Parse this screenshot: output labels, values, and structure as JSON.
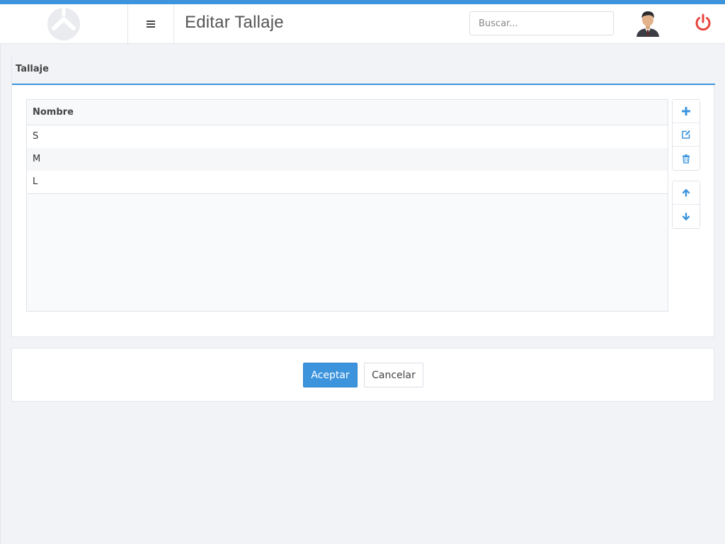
{
  "header": {
    "title": "Editar Tallaje",
    "search_placeholder": "Buscar...",
    "logo_icon": "app-logo-icon",
    "menu_icon": "hamburger-menu-icon",
    "avatar_icon": "user-avatar-icon",
    "power_icon": "power-icon"
  },
  "panel": {
    "tab_label": "Tallaje",
    "grid": {
      "column_header": "Nombre",
      "rows": [
        "S",
        "M",
        "L"
      ]
    },
    "tools": [
      "plus-icon",
      "edit-icon",
      "trash-icon",
      "arrow-up-icon",
      "arrow-down-icon"
    ]
  },
  "footer": {
    "accept_label": "Aceptar",
    "cancel_label": "Cancelar"
  },
  "colors": {
    "accent": "#3c94dd",
    "power": "#e8423a",
    "background": "#f1f3f7"
  }
}
